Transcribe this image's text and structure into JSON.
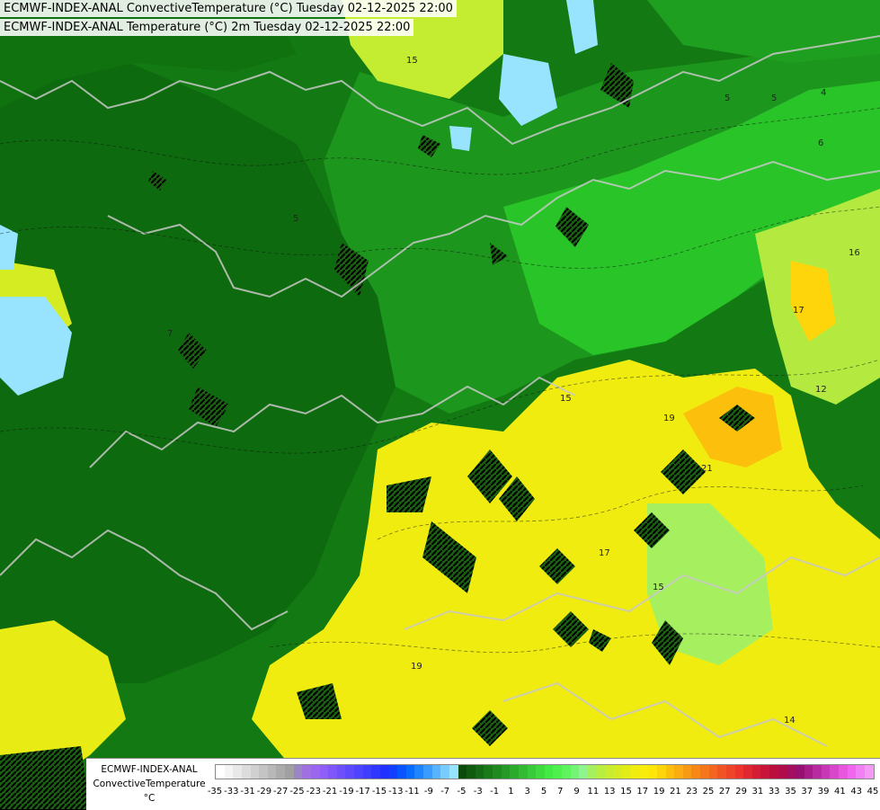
{
  "header": {
    "line1": "ECMWF-INDEX-ANAL ConvectiveTemperature (°C) Tuesday 02-12-2025 22:00",
    "line2": "ECMWF-INDEX-ANAL Temperature (°C) 2m Tuesday 02-12-2025 22:00"
  },
  "legend": {
    "line1": "ECMWF-INDEX-ANAL",
    "line2": "ConvectiveTemperature",
    "line3": "°C",
    "tick_labels": [
      "-35",
      "-33",
      "-31",
      "-29",
      "-27",
      "-25",
      "-23",
      "-21",
      "-19",
      "-17",
      "-15",
      "-13",
      "-11",
      "-9",
      "-7",
      "-5",
      "-3",
      "-1",
      "1",
      "3",
      "5",
      "7",
      "9",
      "11",
      "13",
      "15",
      "17",
      "19",
      "21",
      "23",
      "25",
      "27",
      "29",
      "31",
      "33",
      "35",
      "37",
      "39",
      "41",
      "43",
      "45"
    ],
    "colors": [
      "#ffffff",
      "#f4f4f4",
      "#e8e8e8",
      "#dcdcdc",
      "#d0d0d0",
      "#c4c4c4",
      "#b8b8b8",
      "#ababab",
      "#a0a0a0",
      "#9a86c4",
      "#a070e0",
      "#9a66ee",
      "#8f5ef7",
      "#7e56fa",
      "#6e50fb",
      "#5e4afc",
      "#4e44fd",
      "#3e3efe",
      "#2f36ff",
      "#2030ff",
      "#1240ff",
      "#0a55ff",
      "#0a6cff",
      "#1e84ff",
      "#3a9cff",
      "#58b4ff",
      "#78ccff",
      "#98e4ff",
      "#0a4a0a",
      "#0f5a0f",
      "#146a14",
      "#1a7a1a",
      "#208a20",
      "#269a26",
      "#2caa2c",
      "#32ba32",
      "#38ca38",
      "#3eda3e",
      "#44ea44",
      "#4ef04e",
      "#5ef45e",
      "#74f474",
      "#8ef48e",
      "#a6f060",
      "#b8ee40",
      "#c8ec30",
      "#d6ec22",
      "#e4ec16",
      "#f0ec10",
      "#f8ec0c",
      "#fee60a",
      "#fed40a",
      "#fcc00c",
      "#fbac10",
      "#f99a14",
      "#f78818",
      "#f5761c",
      "#f36620",
      "#f05424",
      "#ee4428",
      "#ec342c",
      "#e02630",
      "#d41c34",
      "#c81438",
      "#bc0e3c",
      "#b00c4a",
      "#a40e5e",
      "#980f72",
      "#a81c8a",
      "#b82aa0",
      "#c838b6",
      "#d846cc",
      "#e856e0",
      "#f066ee",
      "#f080f4",
      "#f49af6"
    ]
  },
  "map_labels": [
    "15",
    "5",
    "6",
    "5",
    "4",
    "16",
    "17",
    "12",
    "15",
    "19",
    "21",
    "17",
    "15",
    "19",
    "14",
    "7",
    "5"
  ]
}
